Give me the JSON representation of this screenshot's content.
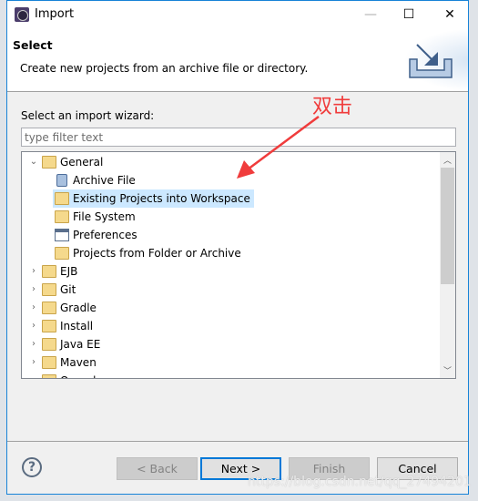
{
  "window": {
    "title": "Import",
    "minimize": "—",
    "maximize": "☐",
    "close": "✕"
  },
  "header": {
    "title": "Select",
    "description": "Create new projects from an archive file or directory."
  },
  "body": {
    "wizard_label": "Select an import wizard:",
    "filter_placeholder": "type filter text",
    "filter_value": ""
  },
  "tree": [
    {
      "label": "General",
      "level": 0,
      "expanded": true,
      "icon": "folder-open-icon"
    },
    {
      "label": "Archive File",
      "level": 1,
      "icon": "archive-file-icon"
    },
    {
      "label": "Existing Projects into Workspace",
      "level": 1,
      "icon": "existing-projects-icon",
      "selected": true
    },
    {
      "label": "File System",
      "level": 1,
      "icon": "folder-icon"
    },
    {
      "label": "Preferences",
      "level": 1,
      "icon": "preferences-icon"
    },
    {
      "label": "Projects from Folder or Archive",
      "level": 1,
      "icon": "folder-icon"
    },
    {
      "label": "EJB",
      "level": 0,
      "expanded": false,
      "icon": "folder-open-icon"
    },
    {
      "label": "Git",
      "level": 0,
      "expanded": false,
      "icon": "folder-open-icon"
    },
    {
      "label": "Gradle",
      "level": 0,
      "expanded": false,
      "icon": "folder-open-icon"
    },
    {
      "label": "Install",
      "level": 0,
      "expanded": false,
      "icon": "folder-open-icon"
    },
    {
      "label": "Java EE",
      "level": 0,
      "expanded": false,
      "icon": "folder-open-icon"
    },
    {
      "label": "Maven",
      "level": 0,
      "expanded": false,
      "icon": "folder-open-icon"
    },
    {
      "label": "Oomph",
      "level": 0,
      "expanded": false,
      "icon": "folder-open-icon"
    }
  ],
  "buttons": {
    "help": "?",
    "back": "< Back",
    "next": "Next >",
    "finish": "Finish",
    "cancel": "Cancel"
  },
  "annotation": {
    "text": "双击",
    "color": "#f03c3c"
  },
  "watermark": "https://blog.csdn.net/qq_27494201",
  "colors": {
    "selection": "#cce8ff",
    "accent": "#0078d7"
  }
}
